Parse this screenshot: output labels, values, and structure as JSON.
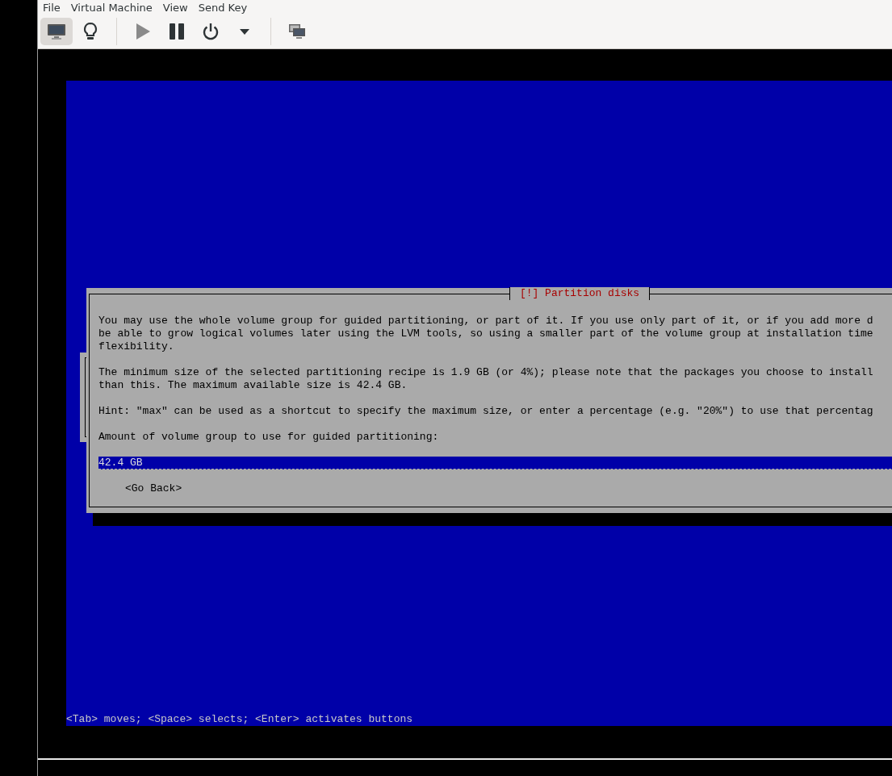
{
  "menu": [
    "File",
    "Virtual Machine",
    "View",
    "Send Key"
  ],
  "toolbar": [
    {
      "kind": "monitor",
      "selected": true
    },
    {
      "kind": "bulb",
      "selected": false
    },
    {
      "kind": "separator"
    },
    {
      "kind": "play",
      "disabled": true
    },
    {
      "kind": "pause",
      "disabled": false
    },
    {
      "kind": "power",
      "disabled": false
    },
    {
      "kind": "caret",
      "disabled": false
    },
    {
      "kind": "separator"
    },
    {
      "kind": "screens"
    }
  ],
  "dialog": {
    "title": "[!] Partition disks",
    "paragraphs": [
      [
        "You may use the whole volume group for guided partitioning, or part of it. If you use only part of it, or if you add more d",
        "be able to grow logical volumes later using the LVM tools, so using a smaller part of the volume group at installation time",
        "flexibility."
      ],
      [
        "The minimum size of the selected partitioning recipe is 1.9 GB (or 4%); please note that the packages you choose to install",
        "than this. The maximum available size is 42.4 GB."
      ],
      [
        "Hint: \"max\" can be used as a shortcut to specify the maximum size, or enter a percentage (e.g. \"20%\") to use that percentag"
      ]
    ],
    "prompt": "Amount of volume group to use for guided partitioning:",
    "value": "42.4 GB",
    "button": "<Go Back>"
  },
  "help": "<Tab> moves; <Space> selects; <Enter> activates buttons"
}
